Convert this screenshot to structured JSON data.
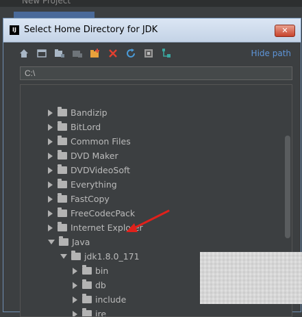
{
  "parent_window": {
    "title": "New Project"
  },
  "dialog": {
    "title": "Select Home Directory for JDK",
    "app_icon_label": "IJ",
    "close_label": "✕"
  },
  "toolbar": {
    "icons": [
      "home-icon",
      "desktop-icon",
      "project-icon",
      "module-icon",
      "new-folder-icon",
      "delete-icon",
      "refresh-icon",
      "show-hidden-icon",
      "tree-link-icon"
    ],
    "hide_path_label": "Hide path"
  },
  "path_field": {
    "value": "C:\\"
  },
  "tree": {
    "items": [
      {
        "label": "Bandizip",
        "expanded": false,
        "depth": 0
      },
      {
        "label": "BitLord",
        "expanded": false,
        "depth": 0
      },
      {
        "label": "Common Files",
        "expanded": false,
        "depth": 0
      },
      {
        "label": "DVD Maker",
        "expanded": false,
        "depth": 0
      },
      {
        "label": "DVDVideoSoft",
        "expanded": false,
        "depth": 0
      },
      {
        "label": "Everything",
        "expanded": false,
        "depth": 0
      },
      {
        "label": "FastCopy",
        "expanded": false,
        "depth": 0
      },
      {
        "label": "FreeCodecPack",
        "expanded": false,
        "depth": 0
      },
      {
        "label": "Internet Explorer",
        "expanded": false,
        "depth": 0
      },
      {
        "label": "Java",
        "expanded": true,
        "depth": 0
      },
      {
        "label": "jdk1.8.0_171",
        "expanded": true,
        "depth": 1
      },
      {
        "label": "bin",
        "expanded": false,
        "depth": 2
      },
      {
        "label": "db",
        "expanded": false,
        "depth": 2
      },
      {
        "label": "include",
        "expanded": false,
        "depth": 2
      },
      {
        "label": "jre",
        "expanded": false,
        "depth": 2
      }
    ]
  },
  "colors": {
    "annotation_arrow": "#e0211b",
    "link": "#5e95d9",
    "background": "#3c3f41"
  }
}
